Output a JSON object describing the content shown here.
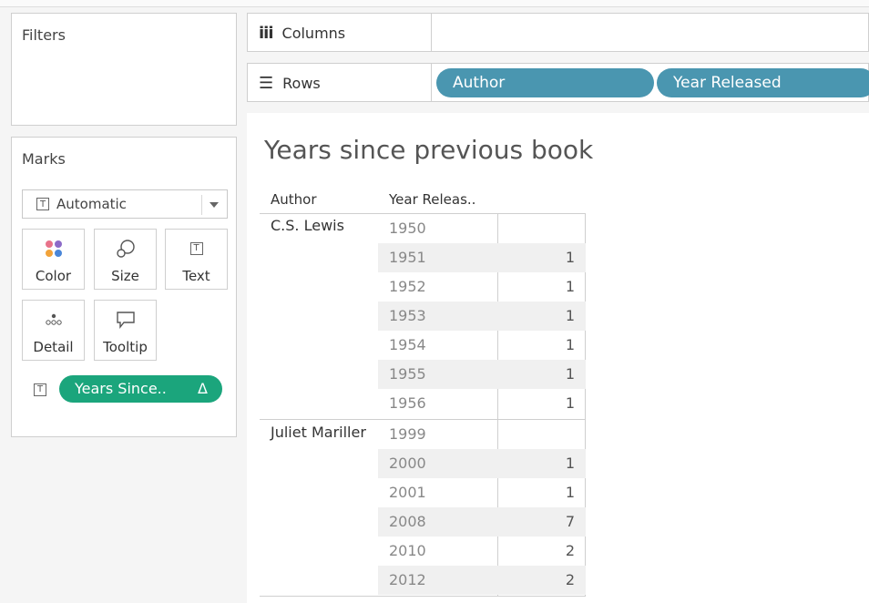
{
  "filters": {
    "title": "Filters"
  },
  "marks": {
    "title": "Marks",
    "mark_type": "Automatic",
    "buttons": [
      {
        "label": "Color",
        "icon": "color-dots-icon"
      },
      {
        "label": "Size",
        "icon": "size-icon"
      },
      {
        "label": "Text",
        "icon": "text-icon"
      },
      {
        "label": "Detail",
        "icon": "detail-dots-icon"
      },
      {
        "label": "Tooltip",
        "icon": "tooltip-icon"
      }
    ],
    "text_field": "Years Since..",
    "text_field_suffix": "Δ",
    "field_color": "#1ba57c"
  },
  "shelves": {
    "columns_label": "Columns",
    "rows_label": "Rows",
    "row_pills": [
      "Author",
      "Year Released"
    ],
    "pill_color": "#4a96b0"
  },
  "view": {
    "title": "Years since previous book",
    "headers": [
      "Author",
      "Year Releas.."
    ],
    "groups": [
      {
        "author": "C.S. Lewis",
        "rows": [
          {
            "year": "1950",
            "value": ""
          },
          {
            "year": "1951",
            "value": "1"
          },
          {
            "year": "1952",
            "value": "1"
          },
          {
            "year": "1953",
            "value": "1"
          },
          {
            "year": "1954",
            "value": "1"
          },
          {
            "year": "1955",
            "value": "1"
          },
          {
            "year": "1956",
            "value": "1"
          }
        ]
      },
      {
        "author": "Juliet Mariller",
        "rows": [
          {
            "year": "1999",
            "value": ""
          },
          {
            "year": "2000",
            "value": "1"
          },
          {
            "year": "2001",
            "value": "1"
          },
          {
            "year": "2008",
            "value": "7"
          },
          {
            "year": "2010",
            "value": "2"
          },
          {
            "year": "2012",
            "value": "2"
          }
        ]
      }
    ]
  }
}
